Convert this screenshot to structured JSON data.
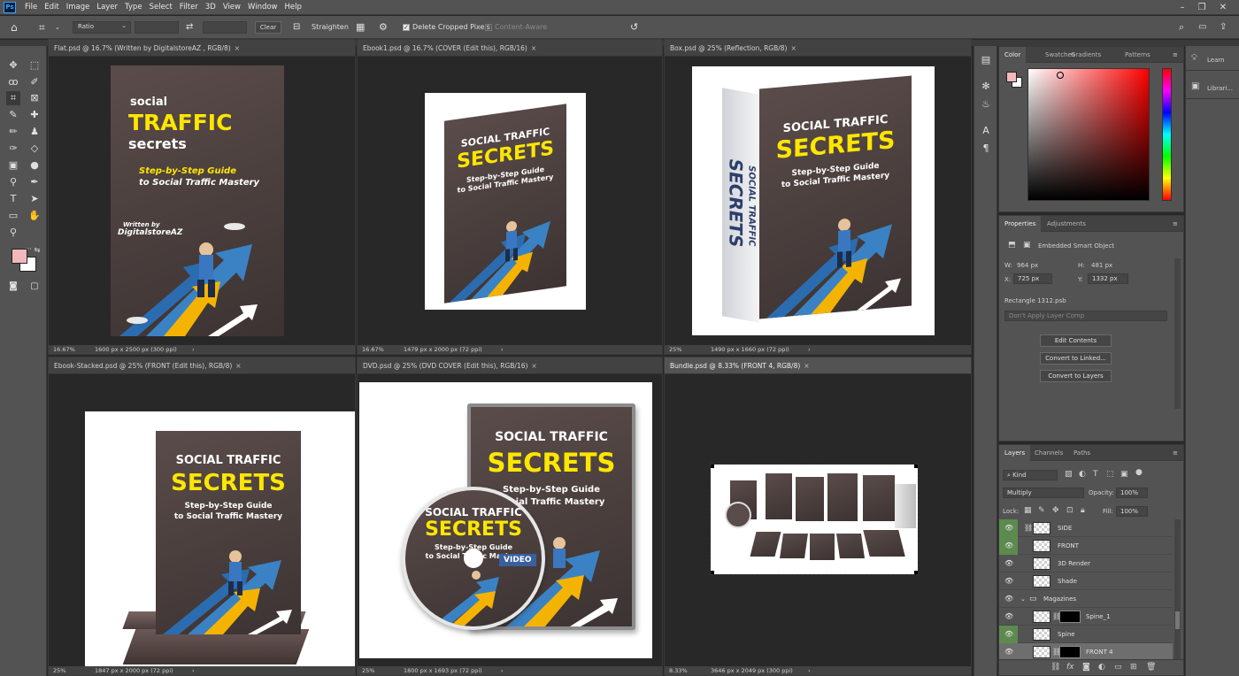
{
  "menu": {
    "app_icon": "Ps",
    "items": [
      "File",
      "Edit",
      "Image",
      "Layer",
      "Type",
      "Select",
      "Filter",
      "3D",
      "View",
      "Window",
      "Help"
    ]
  },
  "window_controls": {
    "minimize": "–",
    "restore": "❐",
    "close": "✕"
  },
  "options": {
    "ratio_label": "Ratio",
    "clear_label": "Clear",
    "straighten_label": "Straighten",
    "delete_cropped_label": "Delete Cropped Pixels",
    "content_aware_label": "Content-Aware",
    "delete_cropped_checked": true
  },
  "documents": [
    {
      "title": "Flat.psd @ 16.7% (Written by  DigitalstoreAZ , RGB/8)",
      "zoom": "16.67%",
      "dims": "1600 px x 2500 px (300 ppi)"
    },
    {
      "title": "Ebook1.psd @ 16.7% (COVER (Edit this), RGB/16)",
      "zoom": "16.67%",
      "dims": "1479 px x 2000 px (72 ppi)"
    },
    {
      "title": "Box.psd @ 25% (Reflection, RGB/8)",
      "zoom": "25%",
      "dims": "1490 px x 1660 px (72 ppi)"
    },
    {
      "title": "Ebook-Stacked.psd @ 25% (FRONT (Edit this), RGB/8)",
      "zoom": "25%",
      "dims": "1847 px x 2000 px (72 ppi)"
    },
    {
      "title": "DVD.psd @ 25% (DVD COVER (Edit this), RGB/16)",
      "zoom": "25%",
      "dims": "1800 px x 1693 px (72 ppi)"
    },
    {
      "title": "Bundle.psd @ 8.33% (FRONT 4, RGB/8)",
      "zoom": "8.33%",
      "dims": "3646 px x 2049 px (300 ppi)"
    }
  ],
  "close_glyph": "×",
  "status_arrow": "›",
  "art": {
    "flat": {
      "line1": "social",
      "line2": "TRAFFIC",
      "line3": "secrets",
      "sub1": "Step-by-Step Guide",
      "sub2": "to Social Traffic Mastery",
      "written": "Written by",
      "author": "DigitalstoreAZ"
    },
    "ebook": {
      "line1": "SOCIAL TRAFFIC",
      "line2": "SECRETS",
      "sub1": "Step-by-Step Guide",
      "sub2": "to Social Traffic Mastery"
    },
    "box": {
      "line1": "SOCIAL TRAFFIC",
      "line2": "SECRETS",
      "sub1": "Step-by-Step Guide",
      "sub2": "to Social Traffic Mastery",
      "spine1": "SOCIAL TRAFFIC",
      "spine2": "SECRETS"
    },
    "stacked": {
      "line1": "SOCIAL TRAFFIC",
      "line2": "SECRETS",
      "sub1": "Step-by-Step Guide",
      "sub2": "to Social Traffic Mastery"
    },
    "dvd": {
      "line1": "SOCIAL TRAFFIC",
      "line2": "SECRETS",
      "sub1": "Step-by-Step Guide",
      "sub2": "Social Traffic Mastery",
      "disc1": "SOCIAL TRAFFIC",
      "disc2": "SECRETS",
      "disc3": "Step-by-Step Guide",
      "disc4": "to Social Traffic Mastery",
      "badge": "VIDEO"
    }
  },
  "color_panel": {
    "tabs": [
      "Color",
      "Swatches",
      "Gradients",
      "Patterns"
    ],
    "fg": "#f4b8bb",
    "bg": "#ffffff"
  },
  "properties": {
    "tabs": [
      "Properties",
      "Adjustments"
    ],
    "type": "Embedded Smart Object",
    "w_label": "W:",
    "w": "964 px",
    "h_label": "H:",
    "h": "481 px",
    "x_label": "X:",
    "x": "725 px",
    "y_label": "Y:",
    "y": "1332 px",
    "layer_name": "Rectangle 1312.psb",
    "layer_comp": "Don't Apply Layer Comp",
    "btn_edit": "Edit Contents",
    "btn_linked": "Convert to Linked...",
    "btn_layers": "Convert to Layers"
  },
  "layers_panel": {
    "tabs": [
      "Layers",
      "Channels",
      "Paths"
    ],
    "kind": "Kind",
    "blend": "Multiply",
    "opacity_label": "Opacity:",
    "opacity": "100%",
    "lock_label": "Lock:",
    "fill_label": "Fill:",
    "fill": "100%",
    "rows": [
      {
        "name": "SIDE",
        "vis": true,
        "green": true
      },
      {
        "name": "FRONT",
        "vis": true,
        "green": true
      },
      {
        "name": "3D Render",
        "vis": true,
        "green": false
      },
      {
        "name": "Shade",
        "vis": true,
        "green": false
      },
      {
        "name": "Magazines",
        "vis": true,
        "green": false,
        "group": true
      },
      {
        "name": "Spine_1",
        "vis": true,
        "green": false,
        "mask": true
      },
      {
        "name": "Spine",
        "vis": true,
        "green": true
      },
      {
        "name": "FRONT 4",
        "vis": true,
        "green": false,
        "mask": true,
        "selected": true
      }
    ]
  },
  "learn": {
    "learn": "Learn",
    "libraries": "Librari..."
  }
}
